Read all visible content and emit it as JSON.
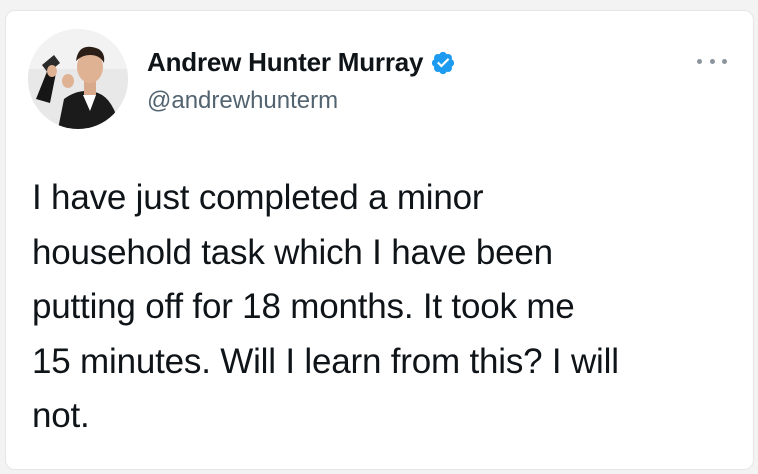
{
  "author": {
    "display_name": "Andrew Hunter Murray",
    "handle": "@andrewhunterm",
    "verified": true,
    "avatar_icon": "profile-photo"
  },
  "tweet": {
    "lines": [
      "I have just completed a minor",
      "household task which I have been",
      "putting off for 18 months. It took me",
      "15 minutes. Will I learn from this? I will",
      "not."
    ]
  },
  "actions": {
    "more_icon": "ellipsis-icon"
  },
  "colors": {
    "verified_badge": "#1d9bf0",
    "text_primary": "#0f1419",
    "text_secondary": "#536471"
  }
}
